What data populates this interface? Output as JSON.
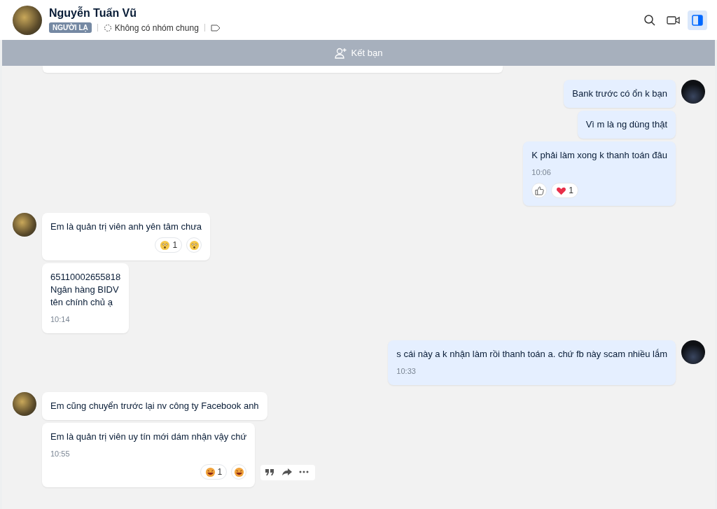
{
  "header": {
    "name": "Nguyễn Tuấn Vũ",
    "badge": "NGƯỜI LẠ",
    "mutual_groups": "Không có nhóm chung",
    "sidebar_toggle": {
      "selected": true
    }
  },
  "add_friend_bar": {
    "label": "Kết bạn"
  },
  "messages": [
    {
      "kind": "outgoing",
      "bubbles": [
        {
          "text": "Bank trước có ổn k bạn"
        },
        {
          "text": "Vì m là ng dùng thật"
        },
        {
          "text": "K phải làm xong k thanh toán đâu",
          "time": "10:06",
          "reactions": [
            {
              "kind": "like"
            },
            {
              "kind": "heart",
              "count": "1"
            }
          ]
        }
      ]
    },
    {
      "kind": "incoming",
      "bubbles": [
        {
          "text": "Em là quản trị viên anh yên tâm chưa",
          "reactions": [
            {
              "kind": "wow",
              "count": "1"
            },
            {
              "kind": "wow"
            }
          ]
        },
        {
          "text": "65110002655818\nNgân hàng BIDV\ntên chính chủ ạ",
          "time": "10:14"
        }
      ]
    },
    {
      "kind": "outgoing",
      "bubbles": [
        {
          "text": "s cái này a k nhận làm rồi thanh toán a. chứ fb này scam nhiều lắm",
          "time": "10:33"
        }
      ]
    },
    {
      "kind": "incoming",
      "bubbles": [
        {
          "text": "Em cũng chuyển trước lại nv công ty Facebook anh"
        },
        {
          "text": "Em là quản trị viên uy tín mới dám nhận vậy chứ",
          "time": "10:55",
          "reactions": [
            {
              "kind": "laugh",
              "count": "1"
            },
            {
              "kind": "laugh"
            }
          ],
          "actions": true
        }
      ]
    }
  ]
}
